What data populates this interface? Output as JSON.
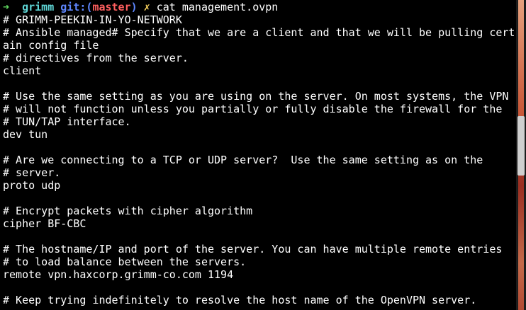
{
  "prompt": {
    "arrow": "➜",
    "user": "grimm",
    "git_label": "git:",
    "branch_open": "(",
    "branch": "master",
    "branch_close": ")",
    "dirty_marker": "✗",
    "command": "cat management.ovpn"
  },
  "output_lines": [
    "# GRIMM-PEEKIN-IN-YO-NETWORK",
    "# Ansible managed# Specify that we are a client and that we will be pulling cert",
    "ain config file",
    "# directives from the server.",
    "client",
    "",
    "# Use the same setting as you are using on the server. On most systems, the VPN",
    "# will not function unless you partially or fully disable the firewall for the",
    "# TUN/TAP interface.",
    "dev tun",
    "",
    "# Are we connecting to a TCP or UDP server?  Use the same setting as on the",
    "# server.",
    "proto udp",
    "",
    "# Encrypt packets with cipher algorithm",
    "cipher BF-CBC",
    "",
    "# The hostname/IP and port of the server. You can have multiple remote entries",
    "# to load balance between the servers.",
    "remote vpn.haxcorp.grimm-co.com 1194",
    "",
    "# Keep trying indefinitely to resolve the host name of the OpenVPN server."
  ],
  "colors": {
    "background": "#000000",
    "text": "#ffffff",
    "arrow": "#5fd75f",
    "user": "#5fd7d7",
    "git": "#5f87ff",
    "branch": "#ff5f5f",
    "dirty": "#ffd75f"
  }
}
